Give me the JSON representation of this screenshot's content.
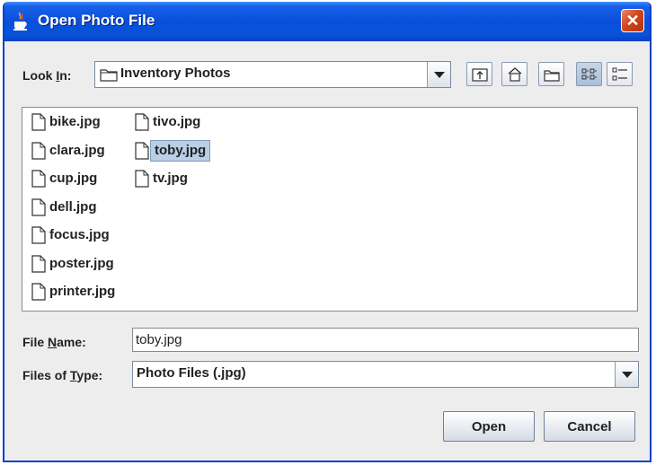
{
  "window": {
    "title": "Open Photo File",
    "title_icon": "java-cup-icon",
    "close_label": "✕"
  },
  "look_in": {
    "label_pre": "Look ",
    "label_mnemonic": "I",
    "label_post": "n:",
    "value": "Inventory Photos",
    "toolbar": [
      "up-one-level-icon",
      "home-icon",
      "new-folder-icon",
      "list-view-icon",
      "details-view-icon"
    ]
  },
  "files": {
    "columns": [
      [
        "bike.jpg",
        "clara.jpg",
        "cup.jpg",
        "dell.jpg",
        "focus.jpg",
        "poster.jpg",
        "printer.jpg"
      ],
      [
        "tivo.jpg",
        "toby.jpg",
        "tv.jpg"
      ]
    ],
    "selected": "toby.jpg"
  },
  "file_name": {
    "label_pre": "File ",
    "label_mnemonic": "N",
    "label_post": "ame:",
    "value": "toby.jpg"
  },
  "file_type": {
    "label_pre": "Files of ",
    "label_mnemonic": "T",
    "label_post": "ype:",
    "value": "Photo Files (.jpg)"
  },
  "buttons": {
    "open": "Open",
    "cancel": "Cancel"
  }
}
